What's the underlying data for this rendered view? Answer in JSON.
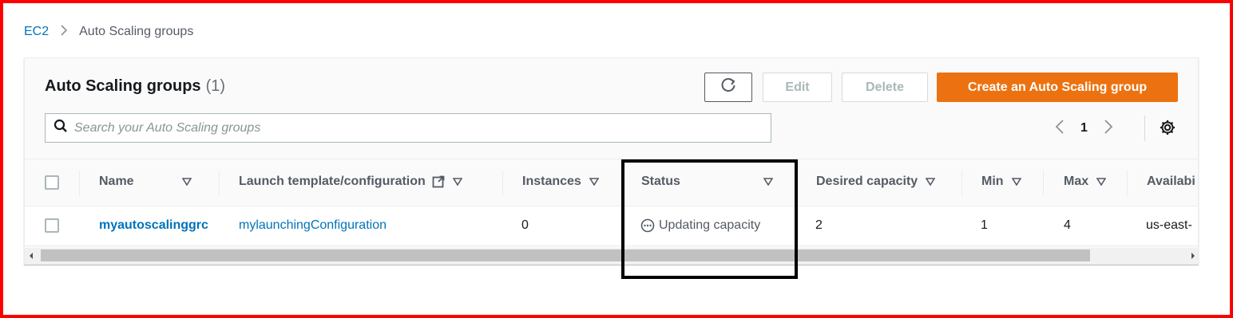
{
  "breadcrumb": {
    "root": "EC2",
    "current": "Auto Scaling groups"
  },
  "panel": {
    "title": "Auto Scaling groups",
    "count": "(1)",
    "buttons": {
      "edit": "Edit",
      "delete": "Delete",
      "create": "Create an Auto Scaling group"
    },
    "search_placeholder": "Search your Auto Scaling groups",
    "pagination": {
      "page": "1"
    }
  },
  "table": {
    "columns": [
      "Name",
      "Launch template/configuration",
      "Instances",
      "Status",
      "Desired capacity",
      "Min",
      "Max",
      "Availabi"
    ],
    "rows": [
      {
        "name": "myautoscalinggrc",
        "launch": "mylaunchingConfiguration",
        "instances": "0",
        "status": "Updating capacity",
        "desired": "2",
        "min": "1",
        "max": "4",
        "availability": "us-east-"
      }
    ]
  },
  "colors": {
    "accent": "#0073bb",
    "primary_button": "#ec7211",
    "frame": "#ff0000",
    "highlight": "#000000"
  },
  "icons": {
    "refresh": "refresh-icon",
    "search": "search-icon",
    "external": "external-link-icon",
    "sort": "sort-caret-icon",
    "settings": "gear-icon",
    "status": "pending-status-icon"
  }
}
